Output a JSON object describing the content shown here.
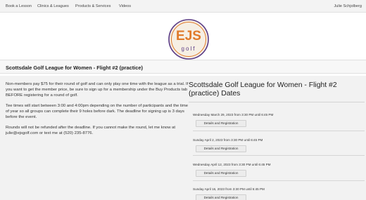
{
  "nav": {
    "items": [
      "Book a Lesson",
      "Clinics & Leagues",
      "Products & Services",
      "Videos"
    ],
    "user": "Julie Schjolberg"
  },
  "logo": {
    "letters": "EJS",
    "word": "golf"
  },
  "page": {
    "title": "Scottsdale Golf League for Women - Flight #2 (practice)"
  },
  "info": {
    "paragraphs": [
      "Non-members pay $75 for their round of golf and can only play one time with the league as a trial. If you want to get the member price, be sure to sign up for a membership under the Buy Products tab BEFORE registering for a round of golf.",
      "Tee times will start between 3:00 and 4:00pm depending on the number of participants and the time of year so all groups can complete their 9 holes before dark. The deadline for signing up is 3 days before the event.",
      "Rounds will not be refunded after the deadline. If you cannot make the round, let me know at julie@ejsgolf.com or text me at (520) 235-8776."
    ]
  },
  "dates": {
    "title": "Scottsdale Golf League for Women - Flight #2 (practice) Dates",
    "button_label": "Details and Registration",
    "entries": [
      "Wednesday March 29, 2023 from 3:30 PM until 6:45 PM",
      "Sunday April 2, 2023 from 3:30 PM until 6:45 PM",
      "Wednesday April 12, 2023 from 3:30 PM until 6:45 PM",
      "Sunday April 16, 2023 from 3:30 PM until 6:45 PM"
    ]
  },
  "colors": {
    "logo_orange": "#e07a2a",
    "logo_purple": "#5a3b86",
    "logo_bg": "#f6efe4"
  }
}
